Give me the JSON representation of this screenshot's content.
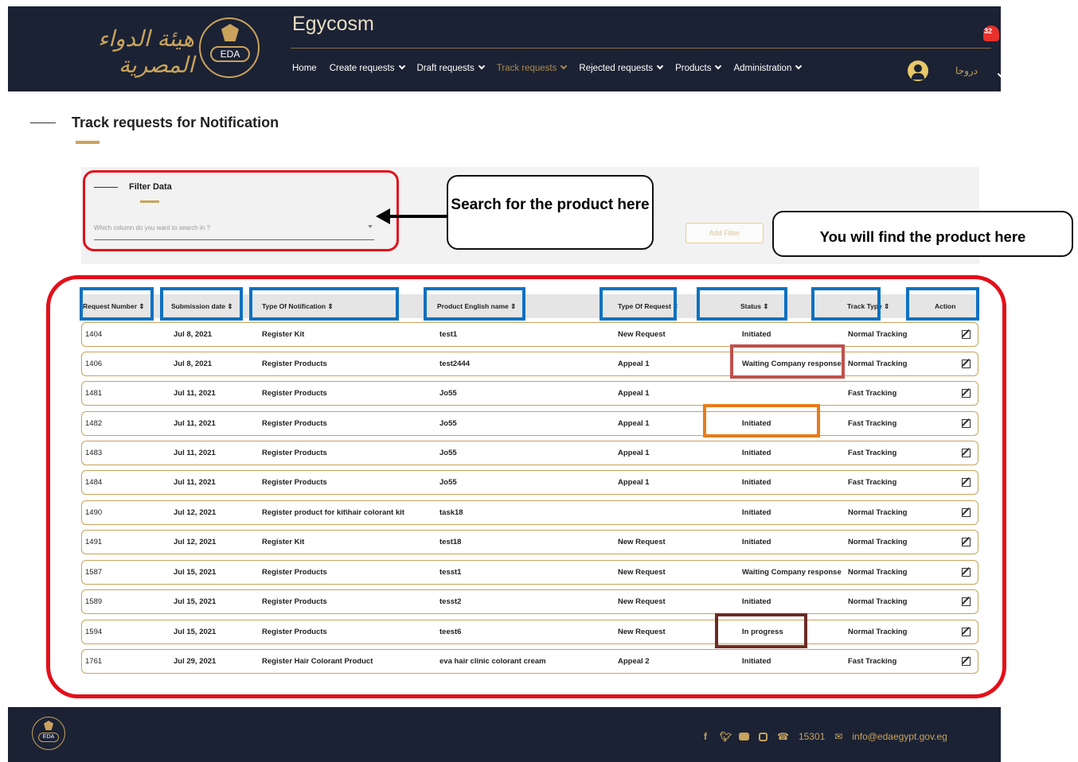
{
  "header": {
    "arabic_logo": "هيئة الدواء المصرية",
    "emblem_text": "EDA",
    "app_title": "Egycosm",
    "nav": [
      {
        "label": "Home",
        "has_menu": false,
        "active": false
      },
      {
        "label": "Create requests",
        "has_menu": true,
        "active": false
      },
      {
        "label": "Draft requests",
        "has_menu": true,
        "active": false
      },
      {
        "label": "Track requests",
        "has_menu": true,
        "active": true
      },
      {
        "label": "Rejected requests",
        "has_menu": true,
        "active": false
      },
      {
        "label": "Products",
        "has_menu": true,
        "active": false
      },
      {
        "label": "Administration",
        "has_menu": true,
        "active": false
      }
    ],
    "language": "دروجا",
    "notification_count": "32"
  },
  "page": {
    "title": "Track requests for Notification"
  },
  "filter": {
    "title": "Filter Data",
    "column_placeholder": "Which column do you want to search in ?",
    "add_filter_label": "Add Filter"
  },
  "callouts": {
    "search": "Search for the product here",
    "find": "You will find the product here"
  },
  "table": {
    "columns": [
      "Request Number ⇕",
      "Submission date ⇕",
      "Type Of Notification ⇕",
      "Product English name ⇕",
      "Type Of Request ⇕",
      "Status ⇕",
      "Track Type ⇕",
      "Action"
    ],
    "rows": [
      {
        "number": "1404",
        "date": "Jul 8, 2021",
        "notification": "Register Kit",
        "product": "test1",
        "request_type": "New Request",
        "status": "Initiated",
        "track": "Normal Tracking"
      },
      {
        "number": "1406",
        "date": "Jul 8, 2021",
        "notification": "Register Products",
        "product": "test2444",
        "request_type": "Appeal 1",
        "status": "Waiting Company response",
        "track": "Normal Tracking"
      },
      {
        "number": "1481",
        "date": "Jul 11, 2021",
        "notification": "Register Products",
        "product": "Jo55",
        "request_type": "Appeal 1",
        "status": "",
        "track": "Fast Tracking"
      },
      {
        "number": "1482",
        "date": "Jul 11, 2021",
        "notification": "Register Products",
        "product": "Jo55",
        "request_type": "Appeal 1",
        "status": "Initiated",
        "track": "Fast Tracking"
      },
      {
        "number": "1483",
        "date": "Jul 11, 2021",
        "notification": "Register Products",
        "product": "Jo55",
        "request_type": "Appeal 1",
        "status": "Initiated",
        "track": "Fast Tracking"
      },
      {
        "number": "1484",
        "date": "Jul 11, 2021",
        "notification": "Register Products",
        "product": "Jo55",
        "request_type": "Appeal 1",
        "status": "Initiated",
        "track": "Fast Tracking"
      },
      {
        "number": "1490",
        "date": "Jul 12, 2021",
        "notification": "Register product for kit\\hair colorant kit",
        "product": "task18",
        "request_type": "",
        "status": "Initiated",
        "track": "Normal Tracking"
      },
      {
        "number": "1491",
        "date": "Jul 12, 2021",
        "notification": "Register Kit",
        "product": "test18",
        "request_type": "New Request",
        "status": "Initiated",
        "track": "Normal Tracking"
      },
      {
        "number": "1587",
        "date": "Jul 15, 2021",
        "notification": "Register Products",
        "product": "tesst1",
        "request_type": "New Request",
        "status": "Waiting Company response",
        "track": "Normal Tracking"
      },
      {
        "number": "1589",
        "date": "Jul 15, 2021",
        "notification": "Register Products",
        "product": "tesst2",
        "request_type": "New Request",
        "status": "Initiated",
        "track": "Normal Tracking"
      },
      {
        "number": "1594",
        "date": "Jul 15, 2021",
        "notification": "Register Products",
        "product": "teest6",
        "request_type": "New Request",
        "status": "In progress",
        "track": "Normal Tracking"
      },
      {
        "number": "1761",
        "date": "Jul 29, 2021",
        "notification": "Register Hair Colorant Product",
        "product": "eva hair clinic colorant cream",
        "request_type": "Appeal 2",
        "status": "Initiated",
        "track": "Fast Tracking"
      }
    ]
  },
  "footer": {
    "emblem_text": "EDA",
    "social_icons": [
      "facebook-icon",
      "twitter-icon",
      "youtube-icon",
      "instagram-icon"
    ],
    "phone": "15301",
    "email": "info@edaegypt.gov.eg"
  },
  "colors": {
    "header_bg": "#1b2234",
    "accent_gold": "#c9a35b",
    "annotation_red": "#e3101a",
    "annotation_blue": "#0d71c2",
    "annotation_rose": "#c0504d",
    "annotation_orange": "#e87b19",
    "annotation_brown": "#6b2b25"
  }
}
